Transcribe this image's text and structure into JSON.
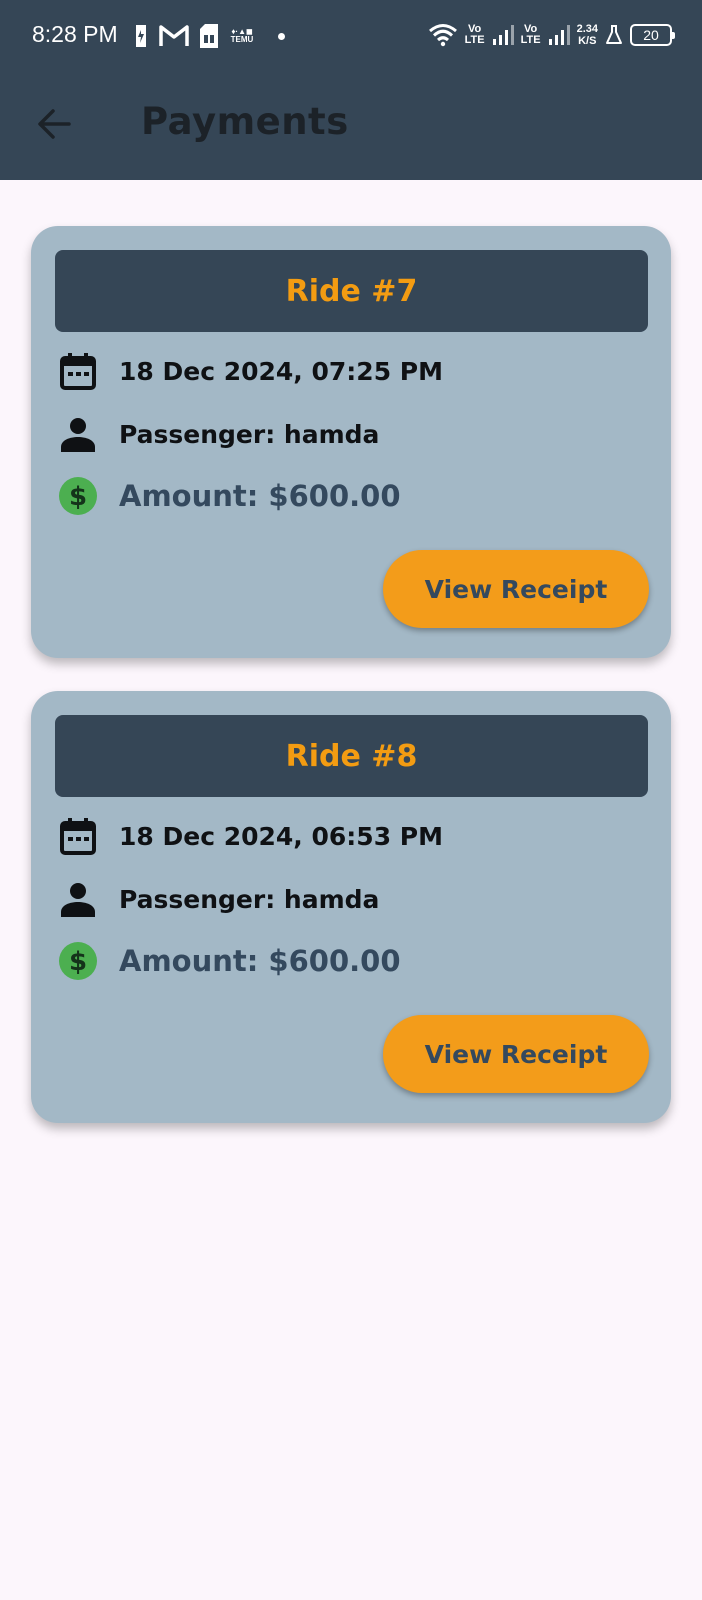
{
  "status_bar": {
    "time": "8:28 PM",
    "left_icons": [
      "battery-saver-icon",
      "gmail-icon",
      "sim-icon",
      "temu-icon",
      "dot-icon"
    ],
    "temu_label": "TEMU",
    "network1": {
      "label_top": "Vo",
      "label_bottom": "LTE"
    },
    "network2": {
      "label_top": "Vo",
      "label_bottom": "LTE"
    },
    "speed_value": "2.34",
    "speed_unit": "K/S",
    "battery_level": "20"
  },
  "app_bar": {
    "title": "Payments",
    "back_icon": "arrow-left-icon"
  },
  "colors": {
    "app_bar": "#354656",
    "background": "#fcf6fc",
    "card": "#a3b8c6",
    "accent": "#f39c12",
    "money_icon": "#4caf50"
  },
  "rides": [
    {
      "title": "Ride #7",
      "datetime": "18 Dec 2024, 07:25 PM",
      "passenger": "Passenger: hamda",
      "amount": "Amount: $600.00",
      "button_label": "View Receipt"
    },
    {
      "title": "Ride #8",
      "datetime": "18 Dec 2024, 06:53 PM",
      "passenger": "Passenger: hamda",
      "amount": "Amount: $600.00",
      "button_label": "View Receipt"
    }
  ]
}
